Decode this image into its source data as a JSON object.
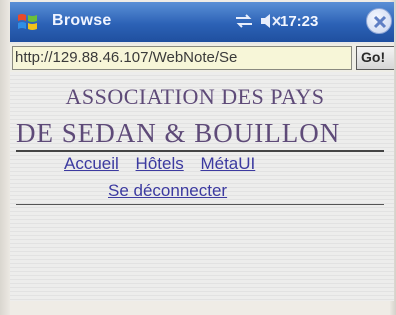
{
  "window": {
    "title": "Browse",
    "clock": "17:23",
    "icons": [
      "windows-start-icon",
      "connectivity-icon",
      "speaker-muted-icon",
      "close-icon"
    ]
  },
  "address_bar": {
    "url": "http://129.88.46.107/WebNote/Se",
    "go_label": "Go!"
  },
  "page": {
    "heading_line1": "ASSOCIATION DES PAYS",
    "heading_line2": "DE SEDAN & BOUILLON",
    "nav_links": [
      "Accueil",
      "Hôtels",
      "MétaUI"
    ],
    "logout_label": "Se déconnecter",
    "link_color": "#3c3aa0",
    "heading_color": "#5e4a78"
  }
}
